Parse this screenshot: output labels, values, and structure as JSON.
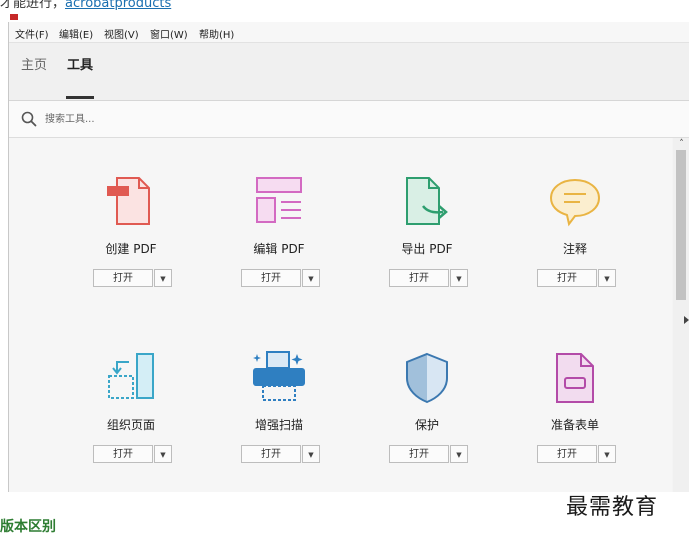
{
  "top_fragment": {
    "prefix": "才能进行，",
    "link": "acrobatproducts"
  },
  "menu": [
    {
      "label": "文件(F)"
    },
    {
      "label": "编辑(E)"
    },
    {
      "label": "视图(V)"
    },
    {
      "label": "窗口(W)"
    },
    {
      "label": "帮助(H)"
    }
  ],
  "tabs": [
    {
      "label": "主页",
      "active": false
    },
    {
      "label": "工具",
      "active": true
    }
  ],
  "search": {
    "placeholder": "搜索工具..."
  },
  "tools": [
    {
      "name": "创建 PDF",
      "icon": "create-pdf-icon",
      "color": "#e05a52",
      "open": "打开"
    },
    {
      "name": "编辑 PDF",
      "icon": "edit-pdf-icon",
      "color": "#d36ac2",
      "open": "打开"
    },
    {
      "name": "导出 PDF",
      "icon": "export-pdf-icon",
      "color": "#2e9e6f",
      "open": "打开"
    },
    {
      "name": "注释",
      "icon": "comment-icon",
      "color": "#e9b443",
      "open": "打开"
    },
    {
      "name": "组织页面",
      "icon": "organize-pages-icon",
      "color": "#3aa6c8",
      "open": "打开"
    },
    {
      "name": "增强扫描",
      "icon": "enhance-scan-icon",
      "color": "#2f7fc1",
      "open": "打开"
    },
    {
      "name": "保护",
      "icon": "protect-icon",
      "color": "#3b78b0",
      "open": "打开"
    },
    {
      "name": "准备表单",
      "icon": "prepare-form-icon",
      "color": "#b34ba8",
      "open": "打开"
    }
  ],
  "scroll_up_symbol": "˄",
  "dropdown_symbol": "▼",
  "watermark": "最需教育",
  "bottom_heading": "版本区别"
}
